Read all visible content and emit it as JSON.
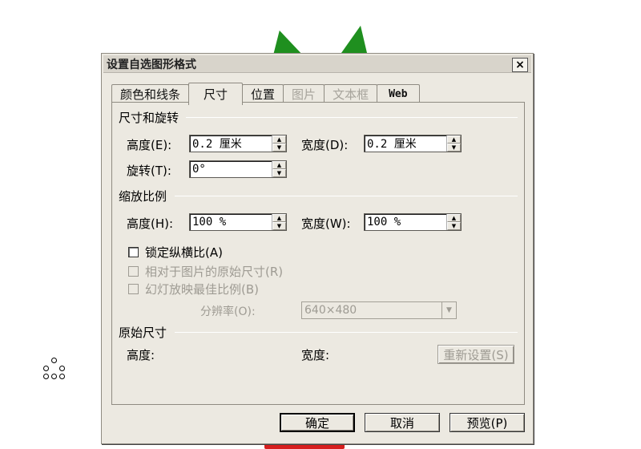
{
  "dialog": {
    "title": "设置自选图形格式",
    "close_label": "×"
  },
  "tabs": [
    {
      "label": "颜色和线条"
    },
    {
      "label": "尺寸"
    },
    {
      "label": "位置"
    },
    {
      "label": "图片"
    },
    {
      "label": "文本框"
    },
    {
      "label": "Web"
    }
  ],
  "size_rotate": {
    "title": "尺寸和旋转",
    "height_label": "高度(E):",
    "height_value": "0.2 厘米",
    "width_label": "宽度(D):",
    "width_value": "0.2 厘米",
    "rotate_label": "旋转(T):",
    "rotate_value": "0°"
  },
  "scale": {
    "title": "缩放比例",
    "height_label": "高度(H):",
    "height_value": "100 %",
    "width_label": "宽度(W):",
    "width_value": "100 %",
    "lock_aspect_label": "锁定纵横比(A)",
    "relative_label": "相对于图片的原始尺寸(R)",
    "slideshow_label": "幻灯放映最佳比例(B)",
    "resolution_label": "分辨率(O):",
    "resolution_value": "640×480"
  },
  "original": {
    "title": "原始尺寸",
    "height_label": "高度:",
    "width_label": "宽度:",
    "reset_label": "重新设置(S)"
  },
  "footer": {
    "ok_label": "确定",
    "cancel_label": "取消",
    "preview_label": "预览(P)"
  },
  "colors": {
    "dialog_bg": "#ece9e1",
    "green_shape": "#1f8f1f",
    "red_shape": "#d61f1f"
  }
}
